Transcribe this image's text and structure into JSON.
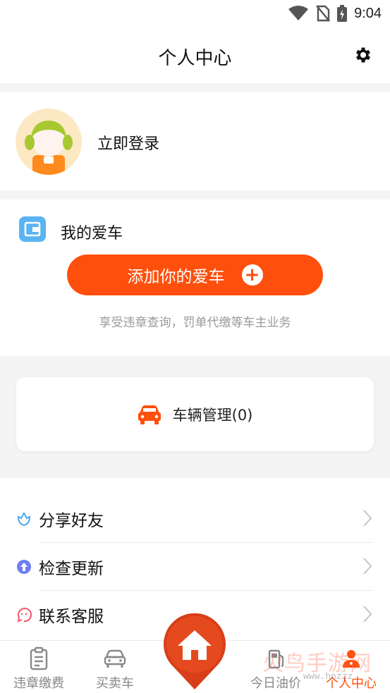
{
  "status_bar": {
    "time": "9:04",
    "icons": [
      "wifi-icon",
      "no-sim-icon",
      "battery-charging-icon"
    ]
  },
  "header": {
    "title": "个人中心",
    "settings_icon": "gear-icon"
  },
  "login": {
    "label": "立即登录",
    "avatar_icon": "girl-avatar"
  },
  "my_car": {
    "title": "我的爱车",
    "icon": "wallet-icon",
    "add_button": "添加你的爱车",
    "add_icon": "plus-icon",
    "tip": "享受违章查询，罚单代缴等车主业务"
  },
  "vehicle_manage": {
    "label": "车辆管理(0)",
    "icon": "car-icon"
  },
  "menu": {
    "items": [
      {
        "label": "分享好友",
        "icon": "share-flower-icon"
      },
      {
        "label": "检查更新",
        "icon": "update-icon"
      },
      {
        "label": "联系客服",
        "icon": "service-icon"
      }
    ]
  },
  "tabbar": {
    "items": [
      {
        "label": "违章缴费",
        "icon": "clipboard-icon",
        "active": false
      },
      {
        "label": "买卖车",
        "icon": "car-icon",
        "active": false
      },
      {
        "label": "今日油价",
        "icon": "fuel-icon",
        "active": false
      },
      {
        "label": "个人中心",
        "icon": "person-icon",
        "active": true
      }
    ],
    "home_icon": "home-icon"
  },
  "watermark": {
    "text": "火鸟手游网",
    "url": "www.hnzzz"
  },
  "colors": {
    "accent": "#ff4f0d",
    "text": "#111111",
    "muted": "#999999",
    "background": "#f4f4f4"
  }
}
